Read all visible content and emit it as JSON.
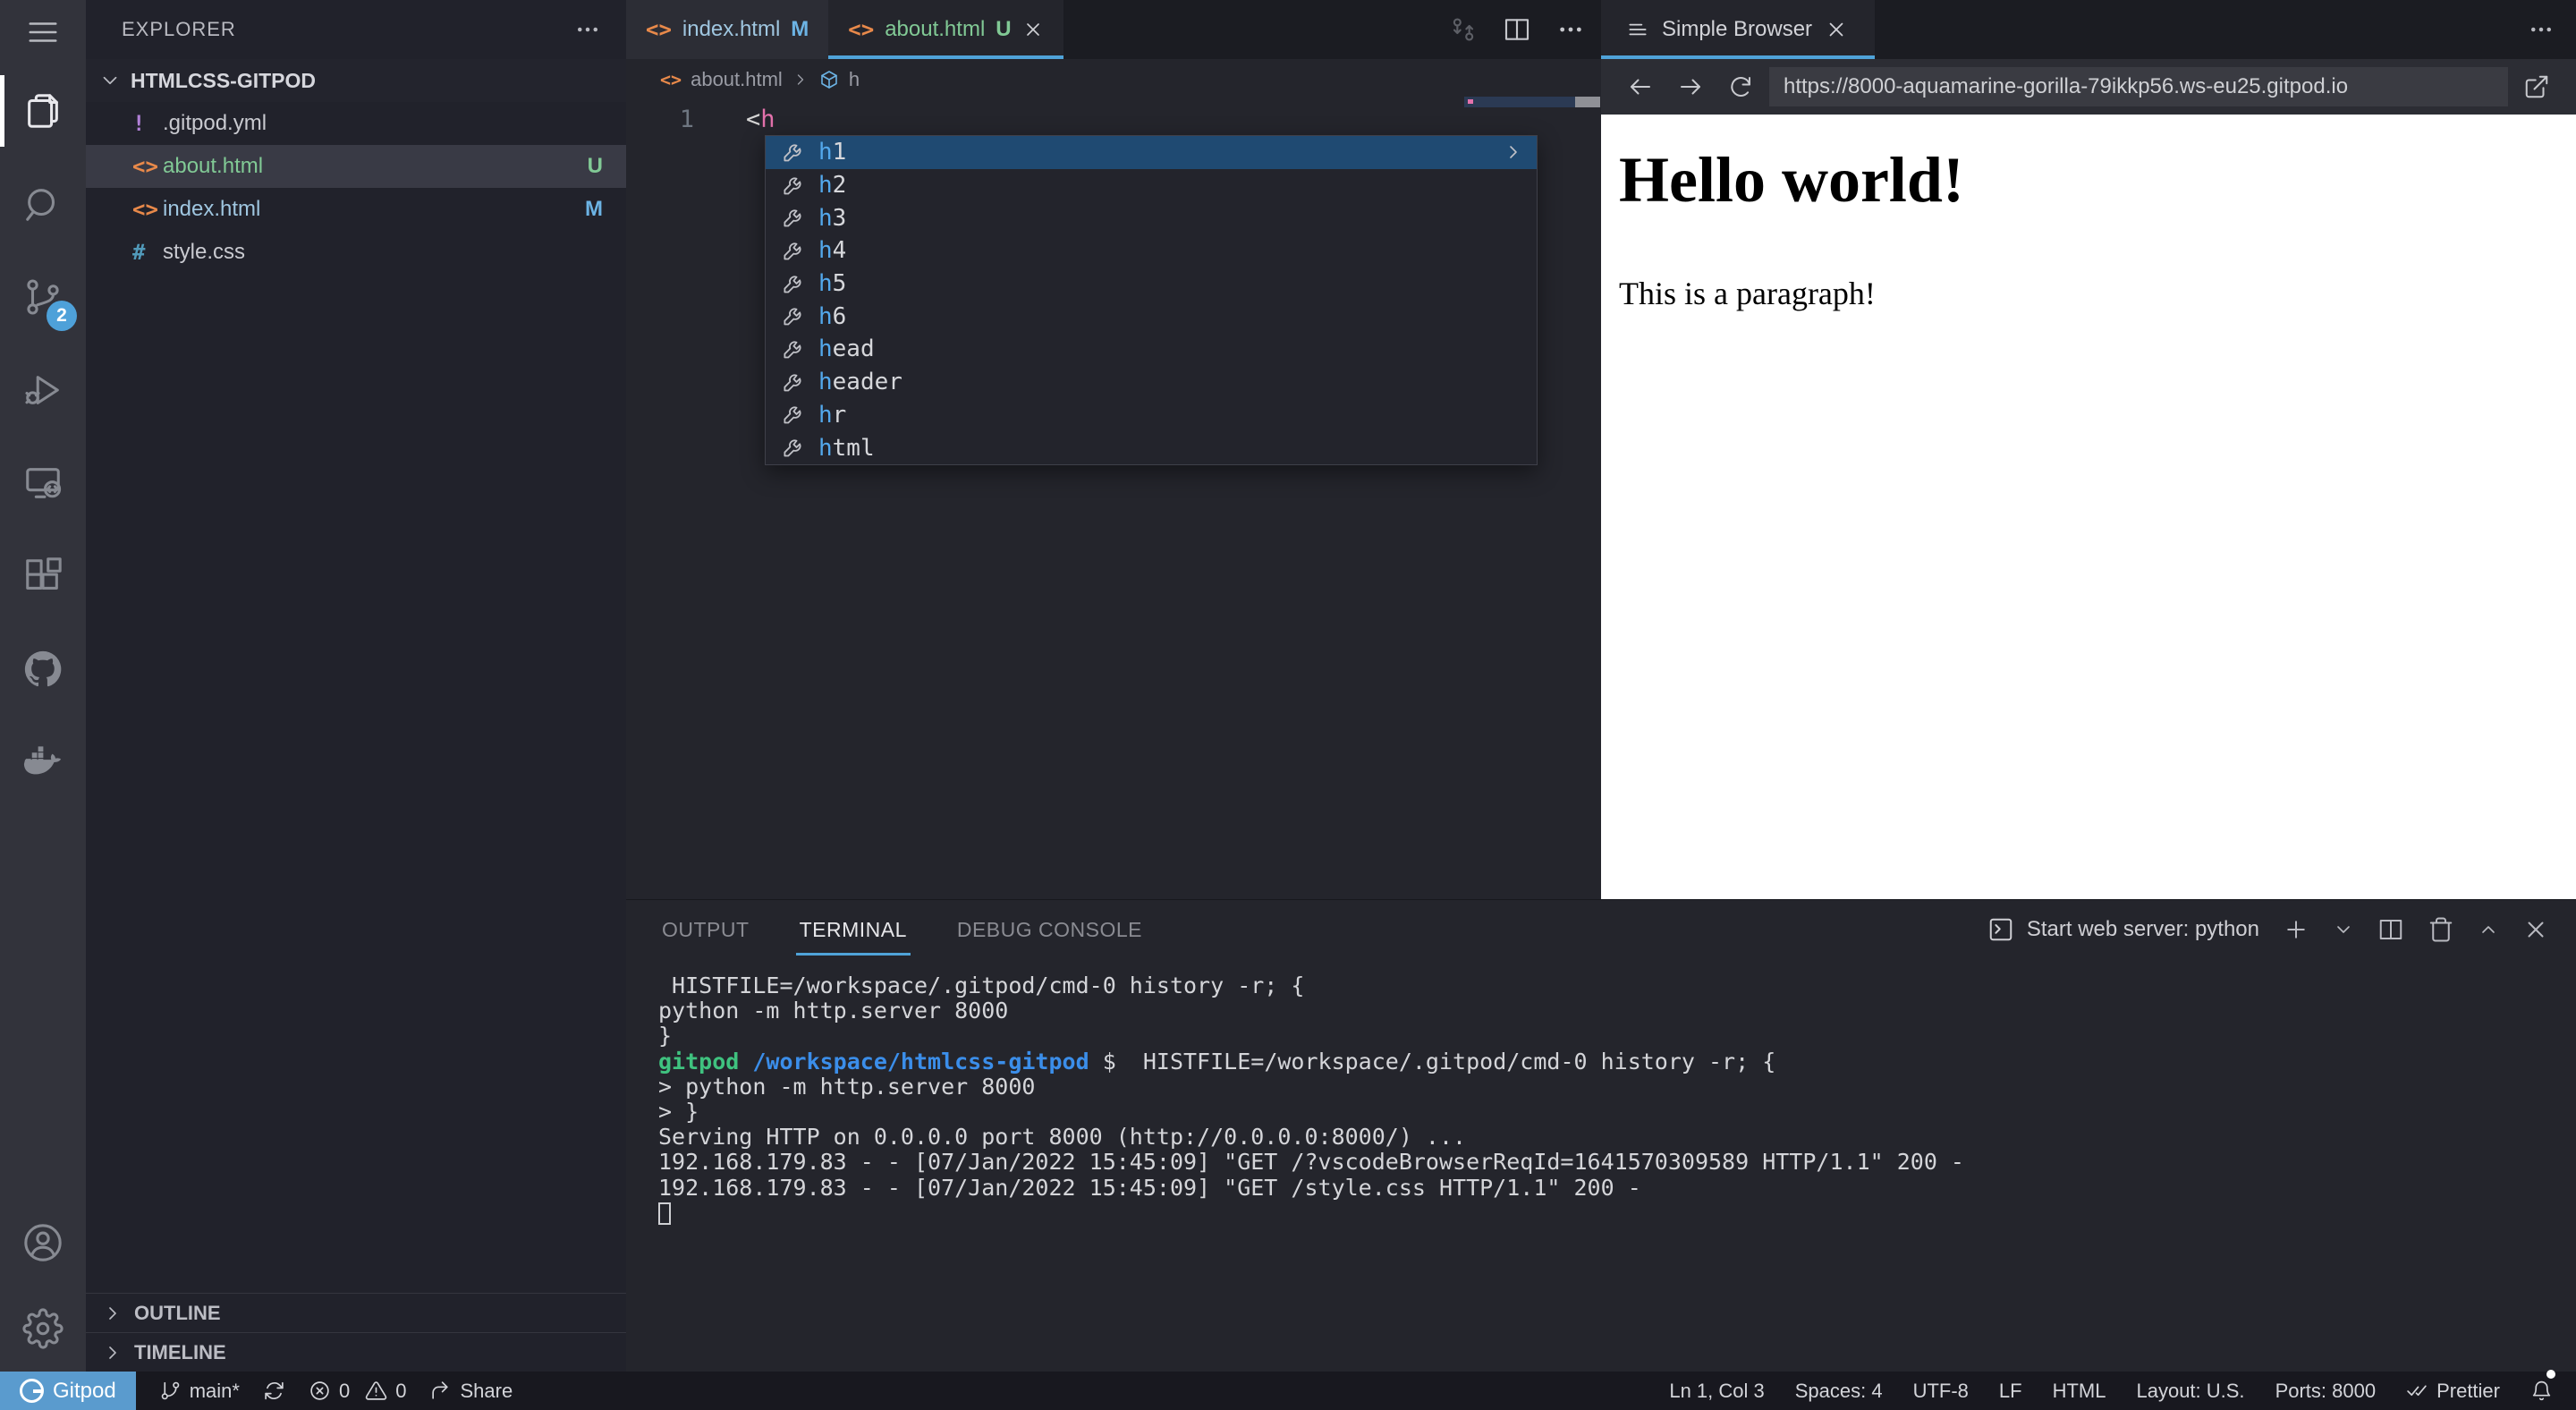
{
  "activity_bar": {
    "icons": [
      "menu",
      "files-explorer",
      "search",
      "source-control",
      "run-debug",
      "remote-explorer",
      "extensions",
      "github",
      "docker"
    ],
    "active_icon": "files-explorer",
    "source_control_badge": "2",
    "bottom_icons": [
      "account",
      "settings-gear"
    ]
  },
  "explorer": {
    "title": "EXPLORER",
    "project": "HTMLCSS-GITPOD",
    "files": [
      {
        "name": ".gitpod.yml",
        "type": "yaml",
        "badge": ""
      },
      {
        "name": "about.html",
        "type": "html",
        "badge": "U",
        "selected": true
      },
      {
        "name": "index.html",
        "type": "html",
        "badge": "M",
        "selected": false
      },
      {
        "name": "style.css",
        "type": "css",
        "badge": ""
      }
    ],
    "sections": {
      "outline": "OUTLINE",
      "timeline": "TIMELINE"
    }
  },
  "editor": {
    "tabs": [
      {
        "name": "index.html",
        "badge": "M",
        "active": false
      },
      {
        "name": "about.html",
        "badge": "U",
        "active": true
      }
    ],
    "breadcrumb": {
      "file": "about.html",
      "symbol": "h"
    },
    "line_number": "1",
    "code": {
      "bracket": "<",
      "tag": "h"
    },
    "suggestions": [
      "h1",
      "h2",
      "h3",
      "h4",
      "h5",
      "h6",
      "head",
      "header",
      "hr",
      "html"
    ],
    "selected_suggestion": "h1",
    "typed_prefix": "h"
  },
  "browser": {
    "tab_title": "Simple Browser",
    "url": "https://8000-aquamarine-gorilla-79ikkp56.ws-eu25.gitpod.io",
    "content": {
      "heading": "Hello world!",
      "paragraph": "This is a paragraph!"
    }
  },
  "panel": {
    "tabs": {
      "output": "OUTPUT",
      "terminal": "TERMINAL",
      "debug": "DEBUG CONSOLE"
    },
    "active_tab": "TERMINAL",
    "terminal_picker": "Start web server: python",
    "terminal_lines": [
      [
        {
          "t": " HISTFILE=/workspace/.gitpod/cmd-0 history -r; {",
          "c": "fg"
        }
      ],
      [
        {
          "t": "python -m http.server 8000",
          "c": "fg"
        }
      ],
      [
        {
          "t": "}",
          "c": "fg"
        }
      ],
      [
        {
          "t": "gitpod ",
          "c": "green"
        },
        {
          "t": "/workspace/htmlcss-gitpod ",
          "c": "blue"
        },
        {
          "t": "$  HISTFILE=/workspace/.gitpod/cmd-0 history -r; {",
          "c": "fg"
        }
      ],
      [
        {
          "t": "> python -m http.server 8000",
          "c": "fg"
        }
      ],
      [
        {
          "t": "> }",
          "c": "fg"
        }
      ],
      [
        {
          "t": "Serving HTTP on 0.0.0.0 port 8000 (http://0.0.0.0:8000/) ...",
          "c": "fg"
        }
      ],
      [
        {
          "t": "192.168.179.83 - - [07/Jan/2022 15:45:09] \"GET /?vscodeBrowserReqId=1641570309589 HTTP/1.1\" 200 -",
          "c": "fg"
        }
      ],
      [
        {
          "t": "192.168.179.83 - - [07/Jan/2022 15:45:09] \"GET /style.css HTTP/1.1\" 200 -",
          "c": "fg"
        }
      ]
    ]
  },
  "status_bar": {
    "remote": "Gitpod",
    "branch": "main*",
    "errors": "0",
    "warnings": "0",
    "share": "Share",
    "line_col": "Ln 1, Col 3",
    "spaces": "Spaces: 4",
    "encoding": "UTF-8",
    "eol": "LF",
    "language": "HTML",
    "layout": "Layout: U.S.",
    "ports": "Ports: 8000",
    "formatter": "Prettier"
  },
  "colors": {
    "accent_blue": "#4fa3d9",
    "git_untracked_green": "#81c995",
    "git_modified_blue": "#9fc6e0",
    "html_icon_orange": "#e8894a",
    "yaml_icon_purple": "#b180d7",
    "css_icon_blue": "#519aba",
    "terminal_fg": "#d4d5d9",
    "terminal_green": "#3fc27f",
    "terminal_blue": "#3b8eea",
    "gitpod_badge_blue": "#5a9bce",
    "suggestion_selected_blue": "#1f4a72",
    "code_tag_pink": "#e472ac",
    "suggestion_match_blue": "#53a8ec"
  }
}
